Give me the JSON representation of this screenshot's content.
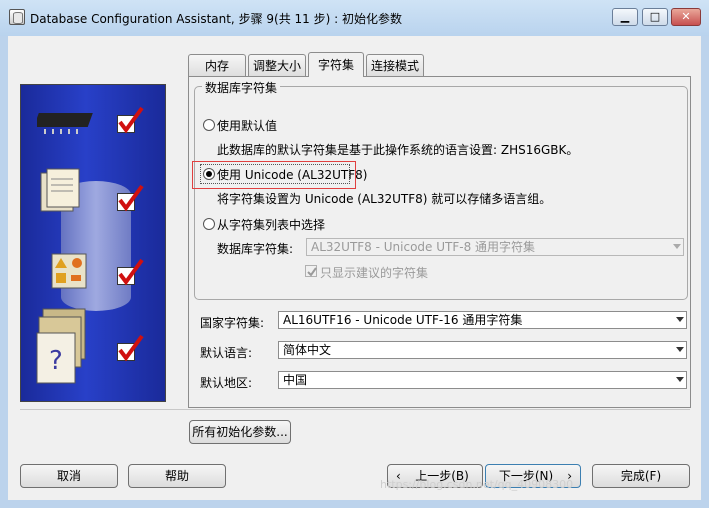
{
  "window": {
    "title": "Database Configuration Assistant, 步骤 9(共 11 步) : 初始化参数",
    "minimize": "▁",
    "maximize": "□",
    "close": "✕"
  },
  "tabs": [
    {
      "label": "内存",
      "active": false
    },
    {
      "label": "调整大小",
      "active": false
    },
    {
      "label": "字符集",
      "active": true
    },
    {
      "label": "连接模式",
      "active": false
    }
  ],
  "charset_group": {
    "title": "数据库字符集",
    "option_default": {
      "label": "使用默认值",
      "selected": false
    },
    "default_desc": "此数据库的默认字符集是基于此操作系统的语言设置: ZHS16GBK。",
    "option_unicode": {
      "label": "使用 Unicode (AL32UTF8)",
      "selected": true
    },
    "unicode_desc": "将字符集设置为 Unicode (AL32UTF8) 就可以存储多语言组。",
    "option_list": {
      "label": "从字符集列表中选择",
      "selected": false
    },
    "db_charset_label": "数据库字符集:",
    "db_charset_value": "AL32UTF8 - Unicode UTF-8 通用字符集",
    "show_recommended_label": "只显示建议的字符集",
    "show_recommended_checked": true
  },
  "national_charset": {
    "label": "国家字符集:",
    "value": "AL16UTF16 - Unicode UTF-16 通用字符集"
  },
  "default_language": {
    "label": "默认语言:",
    "value": "简体中文"
  },
  "default_territory": {
    "label": "默认地区:",
    "value": "中国"
  },
  "all_params_button": "所有初始化参数...",
  "footer": {
    "cancel": "取消",
    "help": "帮助",
    "back": "上一步(B)",
    "next": "下一步(N)",
    "finish": "完成(F)"
  },
  "watermark": "https://blog.csdn.net/qq_40908300",
  "colors": {
    "highlight_box": "#e04040",
    "illustration_bg": "#2840c8"
  }
}
